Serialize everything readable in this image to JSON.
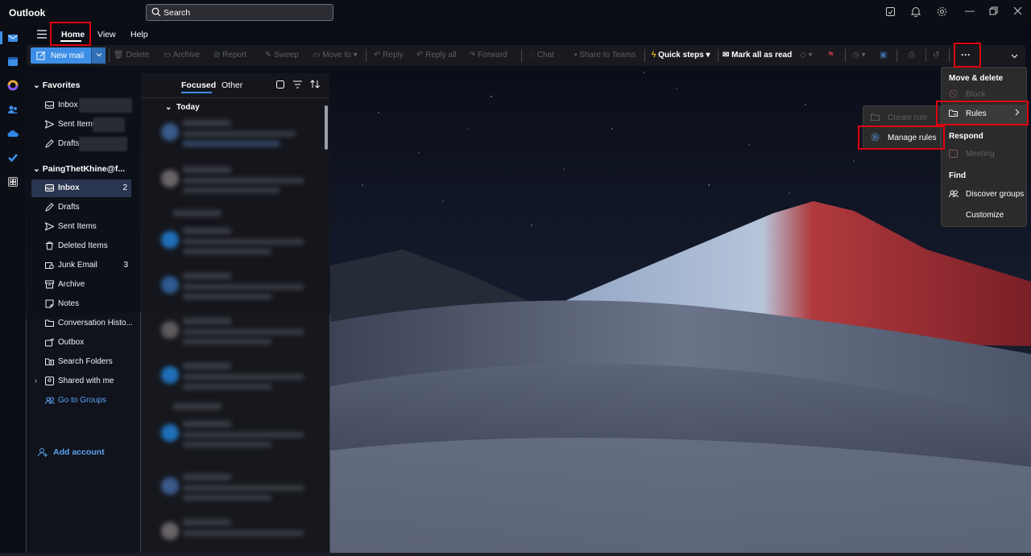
{
  "app": {
    "title": "Outlook"
  },
  "search": {
    "placeholder": "Search"
  },
  "nav_tabs": [
    "Home",
    "View",
    "Help"
  ],
  "ribbon": {
    "new_mail": "New mail",
    "delete": "Delete",
    "archive": "Archive",
    "report": "Report",
    "sweep": "Sweep",
    "move_to": "Move to",
    "reply": "Reply",
    "reply_all": "Reply all",
    "forward": "Forward",
    "chat": "Chat",
    "share_to_teams": "Share to Teams",
    "quick_steps": "Quick steps",
    "mark_all_read": "Mark all as read",
    "more": "···"
  },
  "folders": {
    "favorites_header": "Favorites",
    "favorites": [
      {
        "label": "Inbox"
      },
      {
        "label": "Sent Items"
      },
      {
        "label": "Drafts"
      }
    ],
    "account_header": "PaingThetKhine@f...",
    "items": [
      {
        "label": "Inbox",
        "count": "2"
      },
      {
        "label": "Drafts",
        "count": ""
      },
      {
        "label": "Sent Items",
        "count": ""
      },
      {
        "label": "Deleted Items",
        "count": ""
      },
      {
        "label": "Junk Email",
        "count": "3"
      },
      {
        "label": "Archive",
        "count": ""
      },
      {
        "label": "Notes",
        "count": ""
      },
      {
        "label": "Conversation Histo...",
        "count": ""
      },
      {
        "label": "Outbox",
        "count": ""
      },
      {
        "label": "Search Folders",
        "count": ""
      },
      {
        "label": "Shared with me",
        "count": ""
      },
      {
        "label": "Go to Groups",
        "count": ""
      }
    ],
    "add_account": "Add account"
  },
  "message_list": {
    "tab_focused": "Focused",
    "tab_other": "Other",
    "group_today": "Today"
  },
  "more_menu": {
    "move_delete_header": "Move & delete",
    "block": "Block",
    "rules": "Rules",
    "respond_header": "Respond",
    "meeting": "Meeting",
    "find_header": "Find",
    "discover_groups": "Discover groups",
    "customize": "Customize"
  },
  "rules_submenu": {
    "create_rule": "Create rule",
    "manage_rules": "Manage rules"
  },
  "colors": {
    "accent": "#3d8ee6",
    "highlight": "#e0000f",
    "active_folder": "#2a3550"
  }
}
